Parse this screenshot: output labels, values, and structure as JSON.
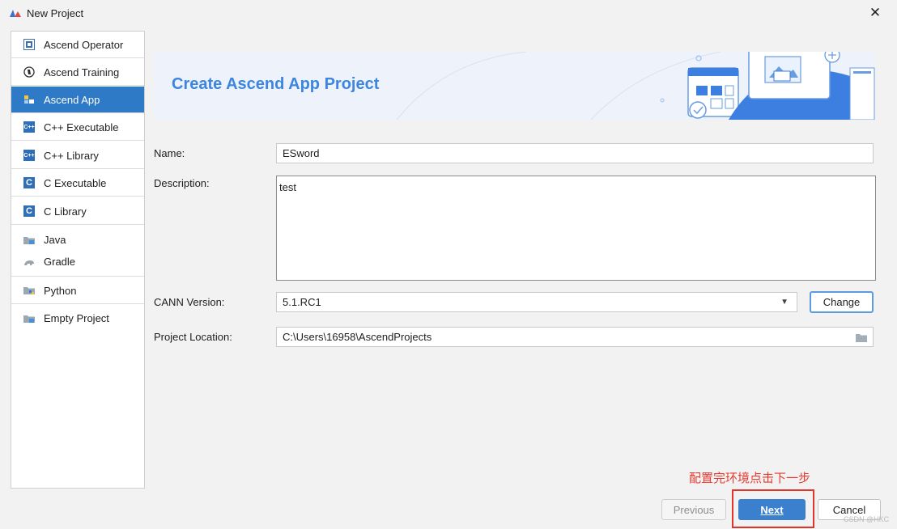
{
  "window": {
    "title": "New Project",
    "close_glyph": "✕"
  },
  "sidebar": {
    "items": [
      {
        "label": "Ascend Operator",
        "icon": "ascend-operator-icon"
      },
      {
        "label": "Ascend Training",
        "icon": "ascend-training-icon"
      },
      {
        "label": "Ascend App",
        "icon": "ascend-app-icon",
        "selected": true
      },
      {
        "label": "C++ Executable",
        "icon": "cpp-executable-icon"
      },
      {
        "label": "C++ Library",
        "icon": "cpp-library-icon"
      },
      {
        "label": "C Executable",
        "icon": "c-executable-icon"
      },
      {
        "label": "C Library",
        "icon": "c-library-icon"
      },
      {
        "label": "Java",
        "icon": "java-folder-icon"
      },
      {
        "label": "Gradle",
        "icon": "gradle-icon"
      },
      {
        "label": "Python",
        "icon": "python-folder-icon"
      },
      {
        "label": "Empty Project",
        "icon": "empty-project-folder-icon"
      }
    ],
    "icon_text": {
      "cpp": "C++",
      "c": "C"
    }
  },
  "banner": {
    "title": "Create Ascend App Project"
  },
  "form": {
    "name_label": "Name:",
    "name_value": "ESword",
    "description_label": "Description:",
    "description_value": "test",
    "cann_label": "CANN Version:",
    "cann_value": "5.1.RC1",
    "cann_dropdown_glyph": "▼",
    "change_label": "Change",
    "location_label": "Project Location:",
    "location_value": "C:\\Users\\16958\\AscendProjects"
  },
  "footer": {
    "previous_label": "Previous",
    "next_label": "Next",
    "cancel_label": "Cancel"
  },
  "annotation": {
    "text": "配置完环境点击下一步"
  },
  "watermark": "CSDN @HKC",
  "colors": {
    "accent": "#2f7ac6",
    "banner_title": "#3d86e0",
    "primary_button": "#3a80cf",
    "annotation_red": "#e83a2e"
  }
}
